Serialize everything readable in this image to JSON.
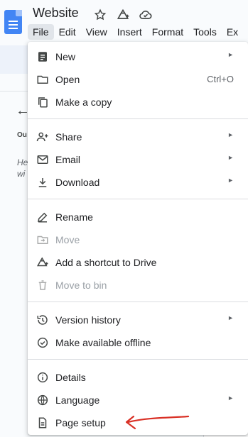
{
  "app": {
    "title": "Website"
  },
  "menubar": {
    "items": [
      "File",
      "Edit",
      "View",
      "Insert",
      "Format",
      "Tools",
      "Ex"
    ]
  },
  "file_menu": {
    "new": {
      "label": "New",
      "icon": "new-doc-icon"
    },
    "open": {
      "label": "Open",
      "shortcut": "Ctrl+O",
      "icon": "folder-icon"
    },
    "make_copy": {
      "label": "Make a copy",
      "icon": "copy-icon"
    },
    "share": {
      "label": "Share",
      "icon": "person-add-icon"
    },
    "email": {
      "label": "Email",
      "icon": "mail-icon"
    },
    "download": {
      "label": "Download",
      "icon": "download-icon"
    },
    "rename": {
      "label": "Rename",
      "icon": "pencil-icon"
    },
    "move": {
      "label": "Move",
      "icon": "move-folder-icon",
      "disabled": true
    },
    "shortcut_drive": {
      "label": "Add a shortcut to Drive",
      "icon": "drive-shortcut-icon"
    },
    "move_bin": {
      "label": "Move to bin",
      "icon": "trash-icon",
      "disabled": true
    },
    "version_history": {
      "label": "Version history",
      "icon": "history-icon"
    },
    "offline": {
      "label": "Make available offline",
      "icon": "offline-check-icon"
    },
    "details": {
      "label": "Details",
      "icon": "info-icon"
    },
    "language": {
      "label": "Language",
      "icon": "globe-icon"
    },
    "page_setup": {
      "label": "Page setup",
      "icon": "page-icon"
    }
  },
  "outline": {
    "label": "Ou",
    "hint_line1": "He",
    "hint_line2": "wi"
  },
  "colors": {
    "accent": "#4285f4",
    "annotation": "#d93025"
  }
}
